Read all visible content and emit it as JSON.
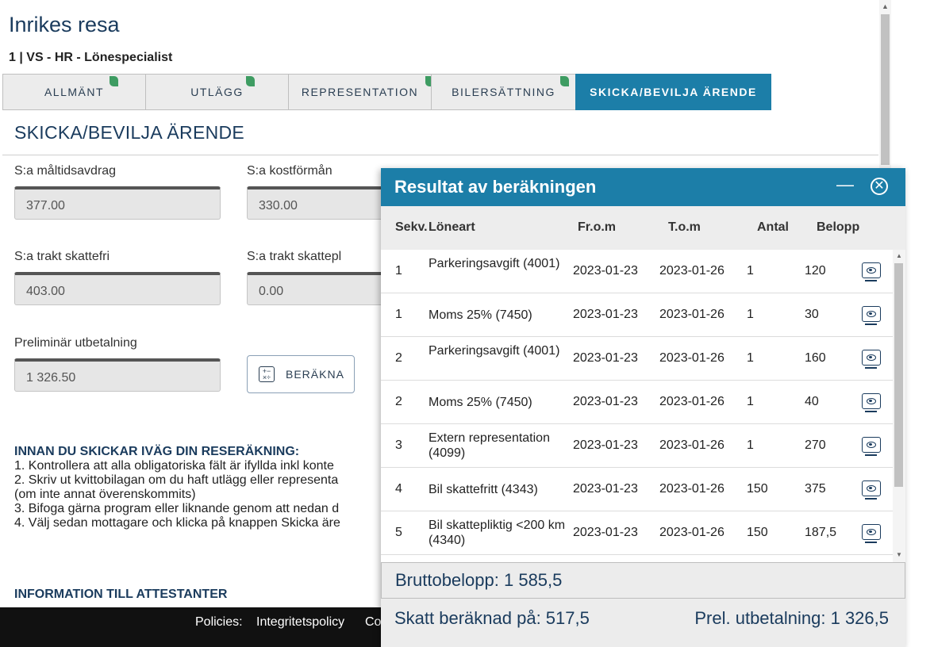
{
  "page": {
    "title": "Inrikes resa",
    "subtitle": "1 | VS - HR - Lönespecialist"
  },
  "tabs": [
    {
      "label": "ALLMÄNT"
    },
    {
      "label": "UTLÄGG"
    },
    {
      "label": "REPRESENTATION"
    },
    {
      "label": "BILERSÄTTNING"
    },
    {
      "label": "SKICKA/BEVILJA ÄRENDE"
    }
  ],
  "section": {
    "title": "SKICKA/BEVILJA ÄRENDE"
  },
  "fields": {
    "maltidsavdrag": {
      "label": "S:a måltidsavdrag",
      "value": "377.00"
    },
    "kostforman": {
      "label": "S:a kostförmån",
      "value": "330.00"
    },
    "trakt_skattefri": {
      "label": "S:a trakt skattefri",
      "value": "403.00"
    },
    "trakt_skattepl": {
      "label": "S:a trakt skattepl",
      "value": "0.00"
    },
    "prel_utbetalning": {
      "label": "Preliminär utbetalning",
      "value": "1 326.50"
    }
  },
  "calc_button": {
    "label": "BERÄKNA"
  },
  "instructions": {
    "heading": "INNAN DU SKICKAR IVÄG DIN RESERÄKNING:",
    "lines": [
      "1. Kontrollera att alla obligatoriska fält är ifyllda inkl konte",
      "2. Skriv ut kvittobilagan om du haft utlägg eller representa",
      "(om inte annat överenskommits)",
      "3. Bifoga gärna program eller liknande genom att nedan d",
      "4. Välj sedan mottagare och klicka på knappen Skicka äre"
    ]
  },
  "info_heading": "INFORMATION TILL ATTESTANTER",
  "footer": {
    "policies_label": "Policies:",
    "privacy_link": "Integritetspolicy",
    "cookie_link": "Co"
  },
  "modal": {
    "title": "Resultat av beräkningen",
    "minimize_glyph": "—",
    "close_glyph": "✕",
    "columns": {
      "seq": "Sekv.",
      "type": "Löneart",
      "from": "Fr.o.m",
      "to": "T.o.m",
      "qty": "Antal",
      "amount": "Belopp"
    },
    "rows": [
      {
        "seq": "1",
        "name": "Parkeringsavgift (4001)",
        "from": "2023-01-23",
        "to": "2023-01-26",
        "qty": "1",
        "amount": "120"
      },
      {
        "seq": "1",
        "name": "Moms 25% (7450)",
        "from": "2023-01-23",
        "to": "2023-01-26",
        "qty": "1",
        "amount": "30"
      },
      {
        "seq": "2",
        "name": "Parkeringsavgift (4001)",
        "from": "2023-01-23",
        "to": "2023-01-26",
        "qty": "1",
        "amount": "160"
      },
      {
        "seq": "2",
        "name": "Moms 25% (7450)",
        "from": "2023-01-23",
        "to": "2023-01-26",
        "qty": "1",
        "amount": "40"
      },
      {
        "seq": "3",
        "name": "Extern representation (4099)",
        "from": "2023-01-23",
        "to": "2023-01-26",
        "qty": "1",
        "amount": "270"
      },
      {
        "seq": "4",
        "name": "Bil skattefritt (4343)",
        "from": "2023-01-23",
        "to": "2023-01-26",
        "qty": "150",
        "amount": "375"
      },
      {
        "seq": "5",
        "name": "Bil skattepliktig <200 km (4340)",
        "from": "2023-01-23",
        "to": "2023-01-26",
        "qty": "150",
        "amount": "187,5"
      }
    ],
    "gross": "Bruttobelopp: 1 585,5",
    "tax_basis": "Skatt beräknad på: 517,5",
    "prel_payout": "Prel. utbetalning: 1 326,5"
  }
}
